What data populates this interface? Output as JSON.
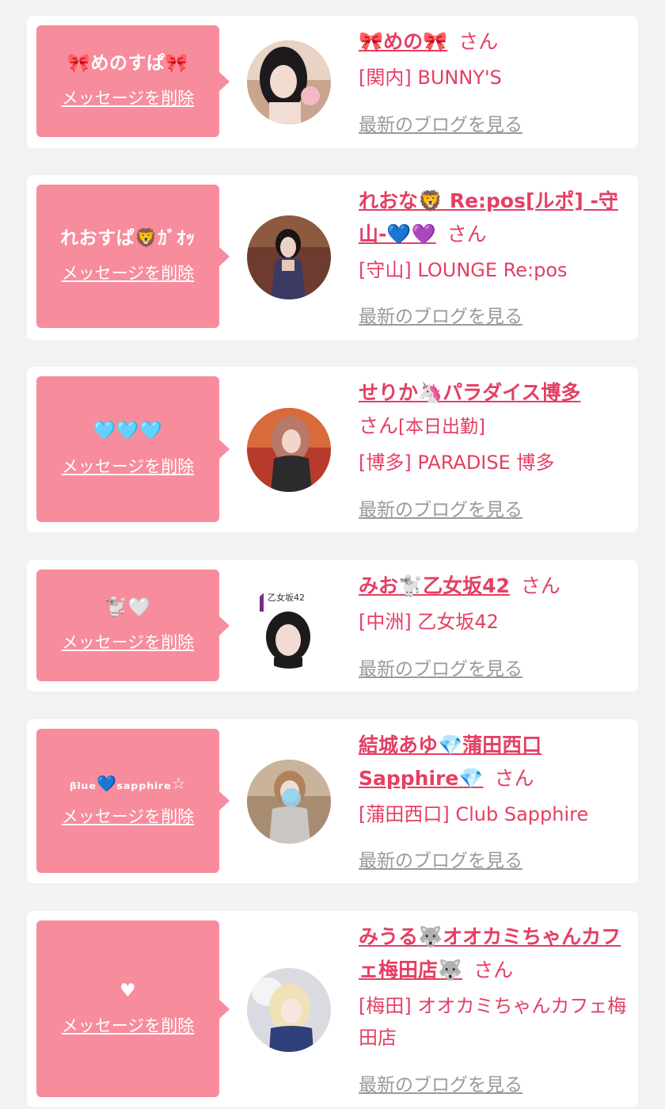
{
  "colors": {
    "accent_pink": "#e43f63",
    "bubble_pink": "#f78c9c",
    "link_gray": "#9a9a9a",
    "page_bg": "#f2f2f2",
    "card_bg": "#ffffff"
  },
  "delete_label": "メッセージを削除",
  "blog_label": "最新のブログを見る",
  "honorific": "さん",
  "entries": [
    {
      "message": "🎀めのすぱ🎀",
      "name": "🎀めの🎀",
      "note": "",
      "shop": "[関内] BUNNY'S"
    },
    {
      "message": "れおすぱ🦁ｶﾞｵｯ",
      "name": "れおな🦁 Re:pos[ルポ] -守山-💙💜",
      "note": "",
      "shop": "[守山] LOUNGE Re:pos"
    },
    {
      "message": "🩵🩵🩵",
      "name": "せりか🦄パラダイス博多",
      "note": "[本日出勤]",
      "shop": "[博多] PARADISE 博多"
    },
    {
      "message": "🐩🤍",
      "name": "みお🐩乙女坂42",
      "note": "",
      "shop": "[中洲] 乙女坂42"
    },
    {
      "message": "ᵦₗᵤₑ💙ₛₐₚₚₕᵢᵣₑ☆",
      "name": "結城あゆ💎蒲田西口Sapphire💎",
      "note": "",
      "shop": "[蒲田西口] Club Sapphire"
    },
    {
      "message": "♥",
      "name": "みうる🐺オオカミちゃんカフェ梅田店🐺",
      "note": "",
      "shop": "[梅田] オオカミちゃんカフェ梅田店"
    }
  ]
}
